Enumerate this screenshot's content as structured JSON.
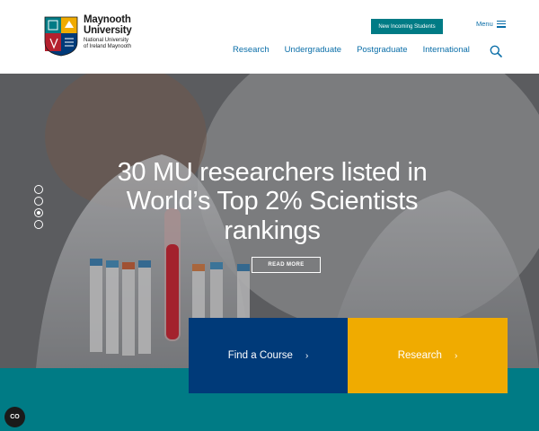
{
  "header": {
    "logo_name_line1": "Maynooth",
    "logo_name_line2": "University",
    "logo_sub_line1": "National University",
    "logo_sub_line2": "of Ireland Maynooth",
    "incoming_label": "New Incoming Students",
    "menu_label": "Menu",
    "nav": [
      "Research",
      "Undergraduate",
      "Postgraduate",
      "International"
    ]
  },
  "hero": {
    "title": "30 MU researchers listed in World’s Top 2% Scientists rankings",
    "read_more_label": "READ MORE",
    "slide_count": 4,
    "active_slide": 3
  },
  "cta": {
    "course_label": "Find a Course",
    "research_label": "Research",
    "chevron": "›"
  },
  "cookie_label": "CO",
  "colors": {
    "teal": "#007b85",
    "navy": "#003a79",
    "gold": "#f0ab00",
    "link_blue": "#0a6ea8"
  }
}
